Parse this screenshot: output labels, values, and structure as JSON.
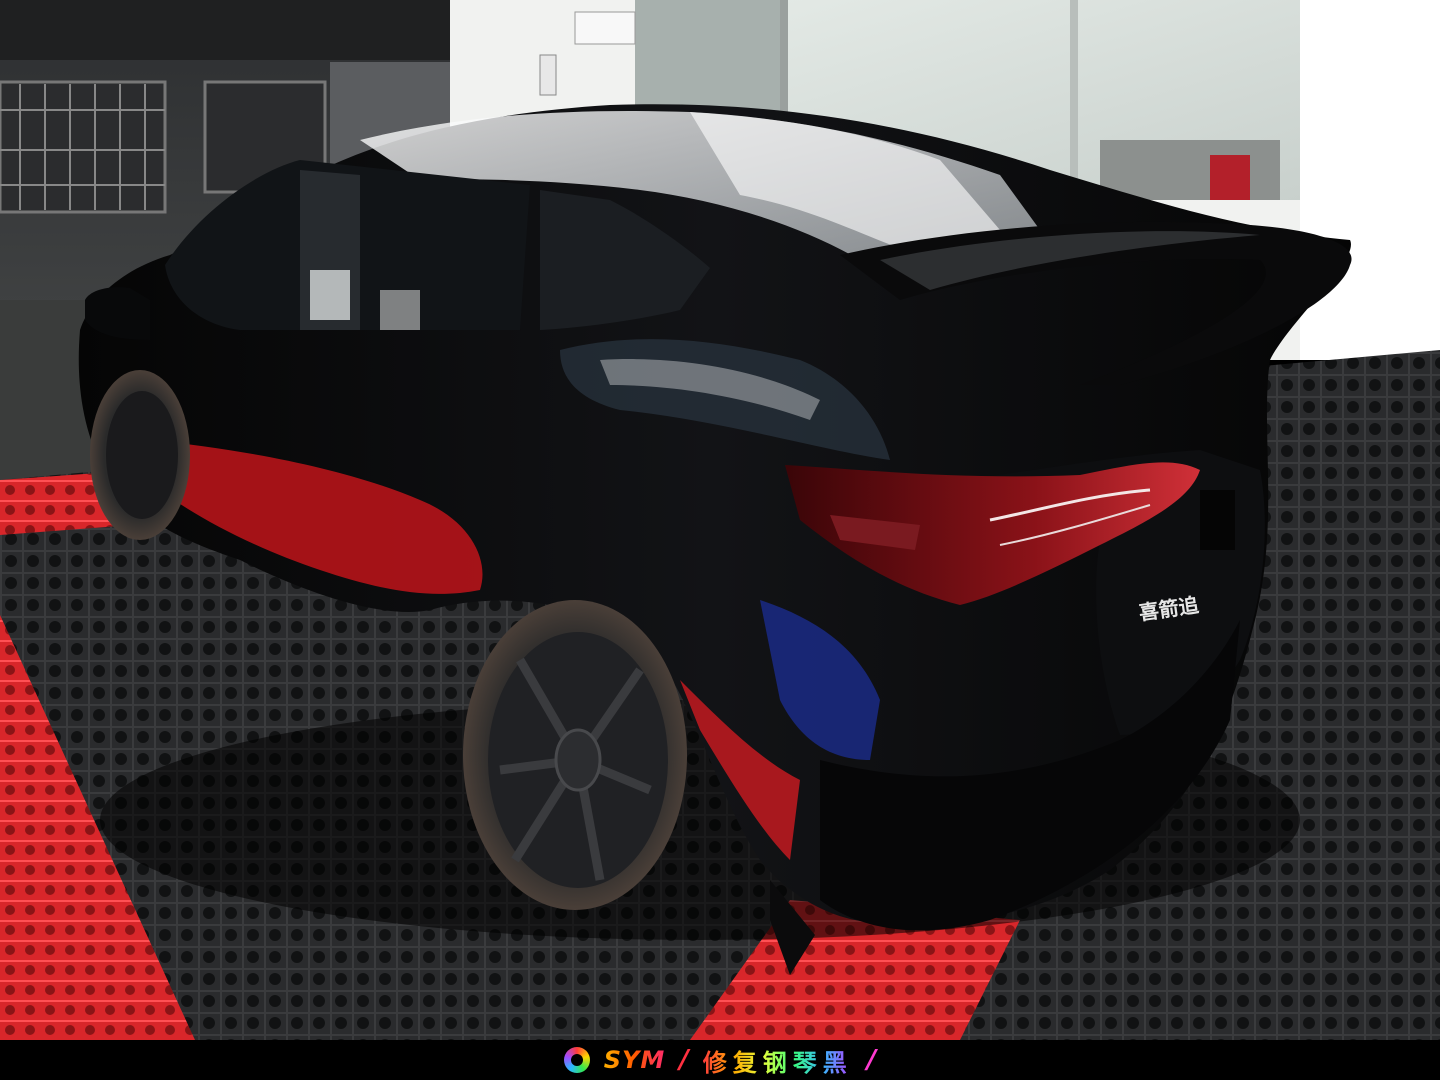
{
  "footer": {
    "brand": "SYM",
    "separator_left": "/",
    "tagline": "修复钢琴黑",
    "separator_right": "/"
  },
  "scene": {
    "badge_text": "喜箭追"
  }
}
